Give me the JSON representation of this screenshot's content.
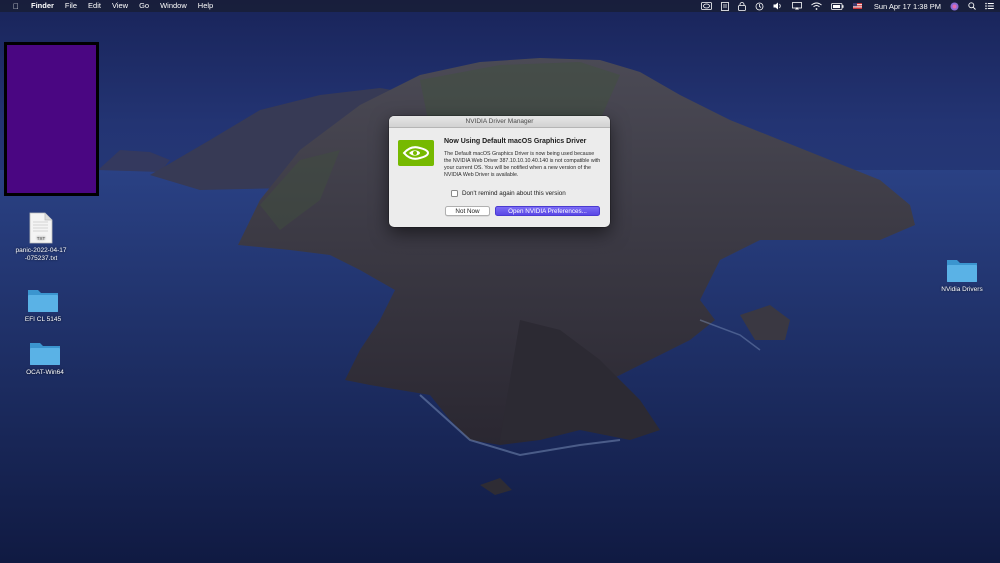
{
  "menubar": {
    "app_name": "Finder",
    "menus": [
      "File",
      "Edit",
      "View",
      "Go",
      "Window",
      "Help"
    ],
    "clock": "Sun Apr 17  1:38 PM"
  },
  "desktop": {
    "icons": [
      {
        "label_line1": "panic-2022-04-17",
        "label_line2": "-075237.txt",
        "type": "txt-file",
        "badge": "TXT"
      },
      {
        "label": "EFI CL 5145",
        "type": "folder"
      },
      {
        "label": "OCAT-Win64",
        "type": "folder"
      },
      {
        "label": "NVidia Drivers",
        "type": "folder"
      }
    ]
  },
  "dialog": {
    "title": "NVIDIA Driver Manager",
    "heading": "Now Using Default macOS Graphics Driver",
    "body": "The Default macOS Graphics Driver is now being used because the NVIDIA Web Driver 387.10.10.10.40.140 is not compatible with your current OS. You will be notified when a new version of the NVIDIA Web Driver is available.",
    "checkbox_label": "Don't remind again about this version",
    "checkbox_checked": false,
    "button_secondary": "Not Now",
    "button_primary": "Open NVIDIA Preferences...",
    "primary_color": "#5a47e6",
    "logo_color": "#76b900"
  },
  "colors": {
    "purple_box": "#4a0682",
    "folder": "#4fa8dc"
  }
}
